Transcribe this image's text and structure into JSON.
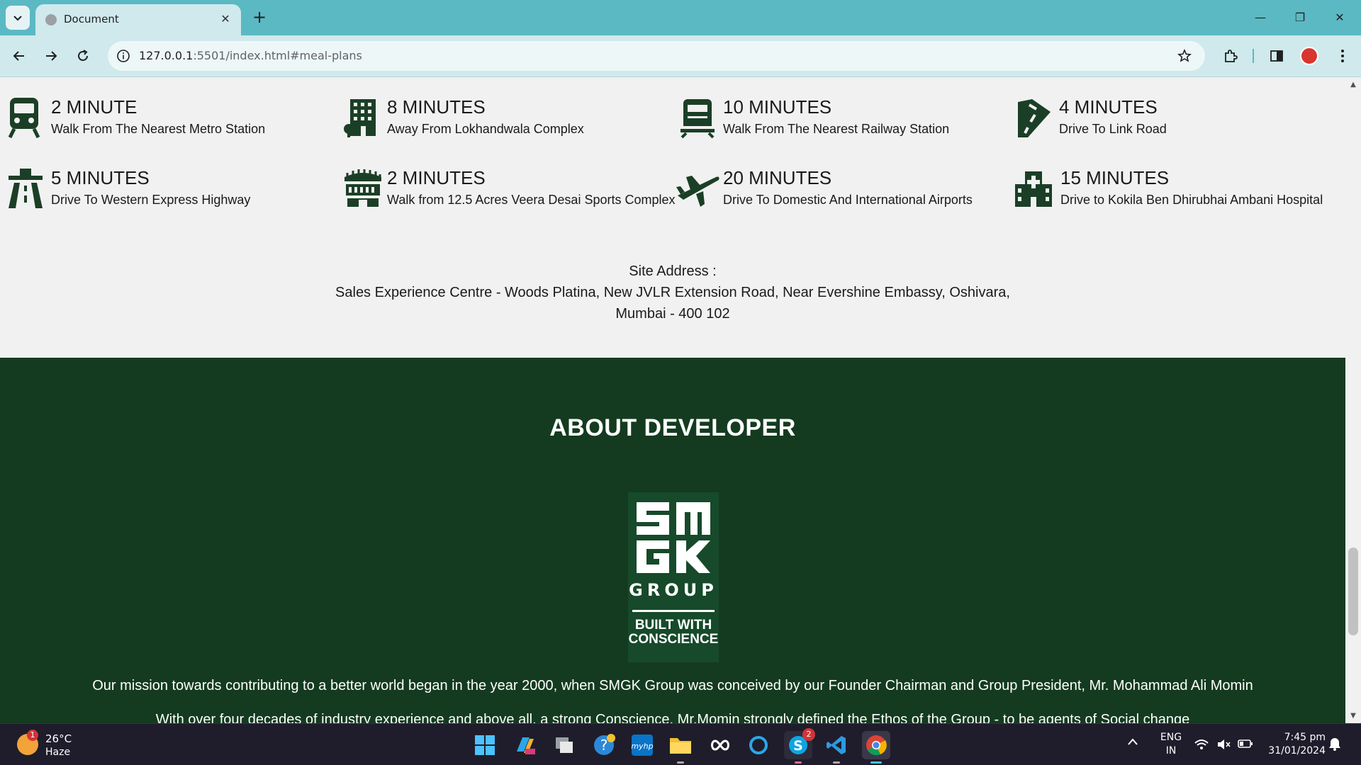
{
  "browser": {
    "tab_title": "Document",
    "url_host": "127.0.0.1",
    "url_rest": ":5501/index.html#meal-plans"
  },
  "location": {
    "items": [
      {
        "title": "2 MINUTE",
        "desc": "Walk From The Nearest Metro Station",
        "icon": "metro-train-icon"
      },
      {
        "title": "8 MINUTES",
        "desc": "Away From Lokhandwala Complex",
        "icon": "building-icon"
      },
      {
        "title": "10 MINUTES",
        "desc": "Walk From The Nearest Railway Station",
        "icon": "railway-train-icon"
      },
      {
        "title": "4 MINUTES",
        "desc": "Drive To Link Road",
        "icon": "road-icon"
      },
      {
        "title": "5 MINUTES",
        "desc": "Drive To Western Express Highway",
        "icon": "highway-icon"
      },
      {
        "title": "2 MINUTES",
        "desc": "Walk from 12.5 Acres Veera Desai Sports Complex",
        "icon": "stadium-icon"
      },
      {
        "title": "20 MINUTES",
        "desc": "Drive To Domestic And International Airports",
        "icon": "airplane-icon"
      },
      {
        "title": "15 MINUTES",
        "desc": "Drive to Kokila Ben Dhirubhai Ambani Hospital",
        "icon": "hospital-icon"
      }
    ],
    "address_label": "Site Address :",
    "address_line1": "Sales Experience Centre - Woods Platina, New JVLR Extension Road, Near Evershine Embassy, Oshivara,",
    "address_line2": "Mumbai - 400 102"
  },
  "developer": {
    "title": "ABOUT DEVELOPER",
    "logo_mark": "SMGK",
    "logo_group": "GROUP",
    "logo_tag1": "BUILT WITH",
    "logo_tag2": "CONSCIENCE",
    "mission": "Our mission towards contributing to a better world began in the year 2000, when SMGK Group was conceived by our Founder Chairman and Group President, Mr. Mohammad Ali Momin",
    "mission_next": "With over four decades of industry experience and above all, a strong Conscience, Mr.Momin strongly defined the Ethos of the Group - to be agents of Social change"
  },
  "taskbar": {
    "weather_temp": "26°C",
    "weather_cond": "Haze",
    "weather_badge": "1",
    "skype_badge": "2",
    "lang1": "ENG",
    "lang2": "IN",
    "time": "7:45 pm",
    "date": "31/01/2024"
  },
  "colors": {
    "chrome_bg": "#5bb9c3",
    "page_bg": "#f1f1f1",
    "developer_bg": "#143b20",
    "icon_green": "#1b3f26"
  }
}
